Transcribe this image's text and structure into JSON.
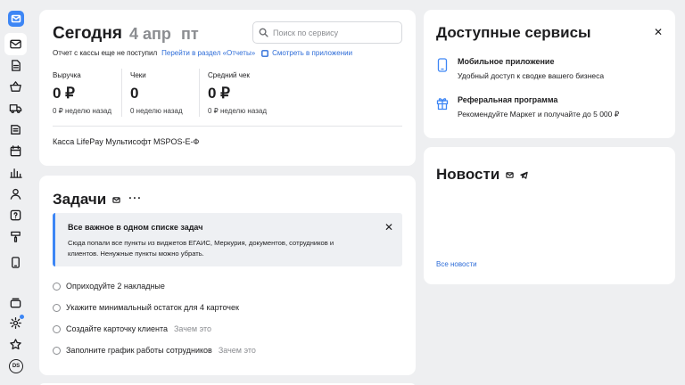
{
  "today": {
    "title": "Сегодня",
    "date": "4 апр",
    "weekday": "пт",
    "search_placeholder": "Поиск по сервису",
    "report_text": "Отчет с кассы еще не поступил",
    "report_link": "Перейти в раздел «Отчеты»",
    "app_link": "Смотреть в приложении",
    "metrics": [
      {
        "label": "Выручка",
        "value": "0 ₽",
        "sub": "0 ₽ неделю назад"
      },
      {
        "label": "Чеки",
        "value": "0",
        "sub": "0 неделю назад"
      },
      {
        "label": "Средний чек",
        "value": "0 ₽",
        "sub": "0 ₽ неделю назад"
      }
    ],
    "kassa": "Касса LifePay Мультисофт MSPOS-E-Ф"
  },
  "tasks": {
    "title": "Задачи",
    "more": "···",
    "notice_title": "Все важное в одном списке задач",
    "notice_text": "Сюда попали все пункты из виджетов ЕГАИС, Меркурия, документов, сотрудников и клиентов. Ненужные пункты можно убрать.",
    "items": [
      {
        "text": "Оприходуйте 2 накладные",
        "hint": ""
      },
      {
        "text": "Укажите минимальный остаток для 4 карточек",
        "hint": ""
      },
      {
        "text": "Создайте карточку клиента",
        "hint": "Зачем это"
      },
      {
        "text": "Заполните график работы сотрудников",
        "hint": "Зачем это"
      }
    ]
  },
  "services": {
    "title": "Доступные сервисы",
    "items": [
      {
        "icon": "phone-icon",
        "title": "Мобильное приложение",
        "desc": "Удобный доступ к сводке вашего бизнеса"
      },
      {
        "icon": "gift-icon",
        "title": "Реферальная программа",
        "desc": "Рекомендуйте Маркет и получайте до 5 000 ₽"
      }
    ]
  },
  "news": {
    "title": "Новости",
    "all_link": "Все новости"
  },
  "sidebar": {
    "avatar": "DS",
    "icons": [
      "mail-icon",
      "document-icon",
      "basket-icon",
      "truck-icon",
      "book-icon",
      "calendar-icon",
      "chart-icon",
      "user-icon",
      "help-icon",
      "brush-icon",
      "tablet-icon",
      "store-icon",
      "gear-icon",
      "star-icon"
    ]
  },
  "colors": {
    "accent": "#3d86f5",
    "link": "#2d6cd8",
    "background": "#eeeff1"
  }
}
